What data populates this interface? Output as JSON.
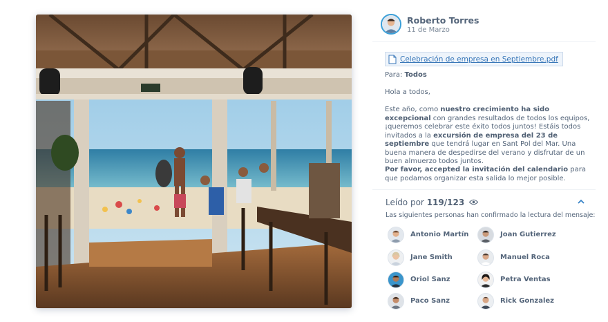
{
  "photo": {
    "alt_icon": "beach-bar-photo"
  },
  "post": {
    "author_name": "Roberto Torres",
    "date": "11 de Marzo",
    "attachment": "Celebración de empresa en Septiembre.pdf",
    "to_label": "Para:",
    "to_value": "Todos",
    "greeting": "Hola a todos,",
    "body_1": "Este año, como ",
    "body_1b": "nuestro crecimiento ha sido excepcional",
    "body_2": " con grandes resultados de todos los equipos, ¡queremos celebrar este éxito todos juntos! Estáis todos invitados a la ",
    "body_2b": "excursión de empresa del 23 de septiembre",
    "body_3": " que tendrá lugar en Sant Pol del Mar. Una buena manera de despedirse del verano y disfrutar de un buen almuerzo todos juntos.",
    "closing_b": "Por favor, accepted la invitación del calendario",
    "closing": " para que podamos organizar esta salida lo mejor posible."
  },
  "read": {
    "label": "Leído por",
    "count": "119/123",
    "subtitle": "Las siguientes personas han confirmado la lectura del mensaje:",
    "readers": [
      {
        "name": "Antonio Martín"
      },
      {
        "name": "Joan Gutierrez"
      },
      {
        "name": "Jane Smith"
      },
      {
        "name": "Manuel Roca"
      },
      {
        "name": "Oriol Sanz"
      },
      {
        "name": "Petra Ventas"
      },
      {
        "name": "Paco Sanz"
      },
      {
        "name": "Rick Gonzalez"
      }
    ]
  },
  "colors": {
    "accent": "#3a9fd8",
    "link": "#3776b8",
    "text": "#54657a"
  }
}
